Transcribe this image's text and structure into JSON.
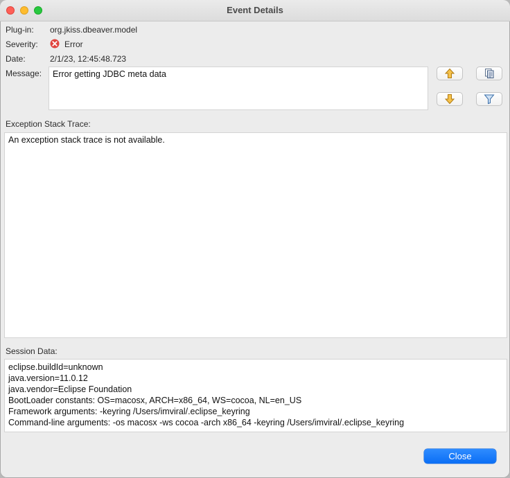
{
  "window": {
    "title": "Event Details"
  },
  "fields": {
    "plugin_label": "Plug-in:",
    "plugin_value": "org.jkiss.dbeaver.model",
    "severity_label": "Severity:",
    "severity_value": "Error",
    "date_label": "Date:",
    "date_value": "2/1/23, 12:45:48.723",
    "message_label": "Message:",
    "message_value": "Error getting JDBC meta data"
  },
  "trace": {
    "label": "Exception Stack Trace:",
    "text": "An exception stack trace is not available."
  },
  "session": {
    "label": "Session Data:",
    "lines": [
      "eclipse.buildId=unknown",
      "java.version=11.0.12",
      "java.vendor=Eclipse Foundation",
      "BootLoader constants: OS=macosx, ARCH=x86_64, WS=cocoa, NL=en_US",
      "Framework arguments:  -keyring /Users/imviral/.eclipse_keyring",
      "Command-line arguments:  -os macosx -ws cocoa -arch x86_64 -keyring /Users/imviral/.eclipse_keyring"
    ]
  },
  "buttons": {
    "close_label": "Close",
    "icons": [
      "arrow-up-icon",
      "copy-icon",
      "arrow-down-icon",
      "filter-icon"
    ]
  },
  "colors": {
    "accent": "#0a6ef5",
    "error": "#e0443e"
  }
}
